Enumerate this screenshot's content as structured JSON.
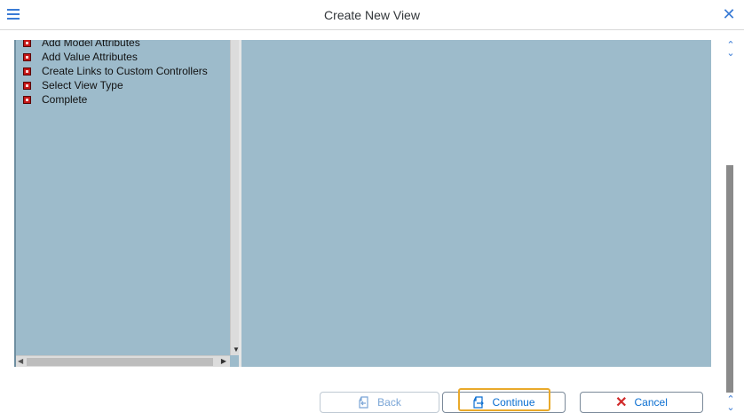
{
  "window": {
    "title": "Create New View"
  },
  "icons": {
    "menu": "hamburger-icon",
    "close": "close-icon",
    "step": "red-step-icon",
    "back": "back-page-icon",
    "continue": "continue-page-icon",
    "cancel": "x-icon"
  },
  "steps": [
    {
      "label": "Add Model Attributes"
    },
    {
      "label": "Add Value Attributes"
    },
    {
      "label": "Create Links to Custom Controllers"
    },
    {
      "label": "Select View Type"
    },
    {
      "label": "Complete"
    }
  ],
  "footer": {
    "back_label": "Back",
    "continue_label": "Continue",
    "cancel_label": "Cancel"
  },
  "colors": {
    "accent": "#0a6ed1",
    "panel_bg": "#9dbbcb",
    "focus": "#e9a92a",
    "cancel_icon": "#d12a2a"
  }
}
